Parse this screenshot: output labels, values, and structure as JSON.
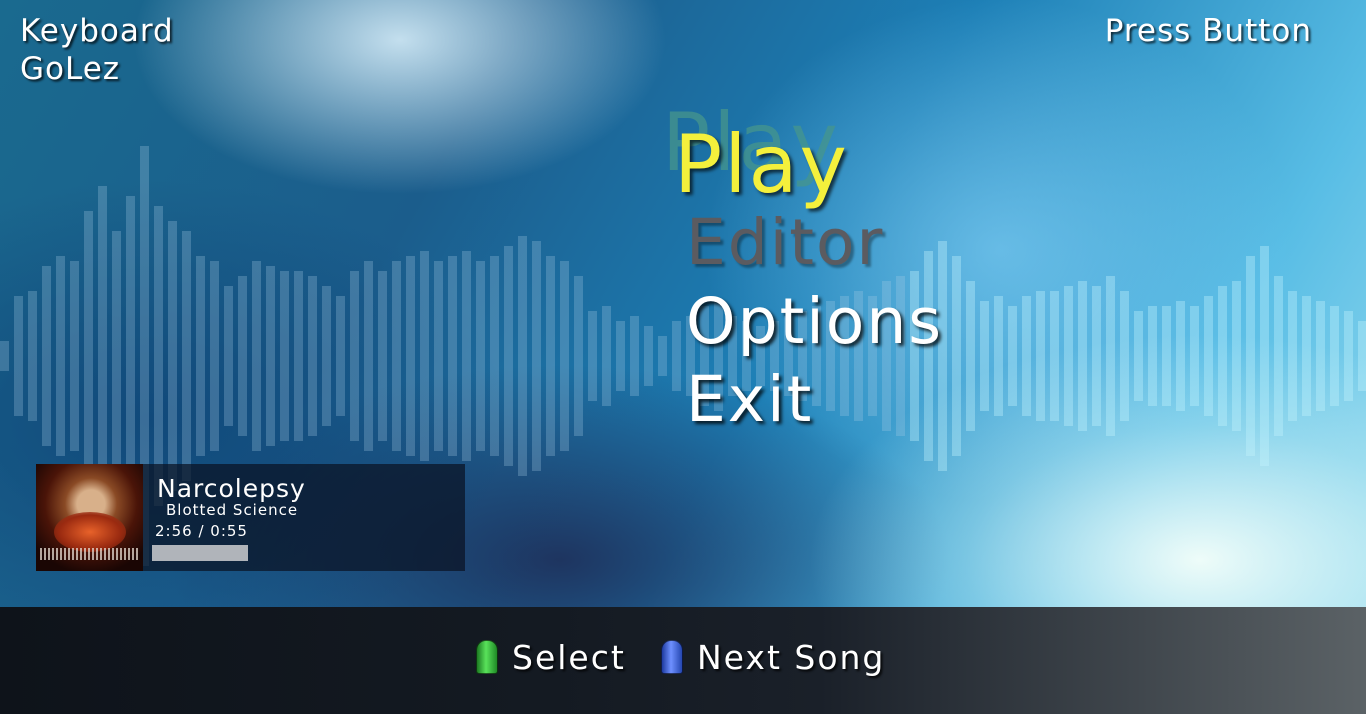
{
  "header": {
    "controller": "Keyboard",
    "player": "GoLez",
    "prompt": "Press Button"
  },
  "menu": {
    "items": [
      {
        "label": "Play",
        "selected": true
      },
      {
        "label": "Editor",
        "disabled": true
      },
      {
        "label": "Options"
      },
      {
        "label": "Exit"
      }
    ]
  },
  "now_playing": {
    "title": "Narcolepsy",
    "artist": "Blotted Science",
    "time": "2:56 / 0:55",
    "progress": 1.0
  },
  "footer": {
    "hints": [
      {
        "icon": "green-fret-icon",
        "label": "Select",
        "color": "#3fcf45"
      },
      {
        "icon": "blue-fret-icon",
        "label": "Next Song",
        "color": "#4f74f0"
      }
    ]
  },
  "colors": {
    "selected": "#f4f03c",
    "disabled": "#5b5b60",
    "normal": "#ffffff"
  }
}
